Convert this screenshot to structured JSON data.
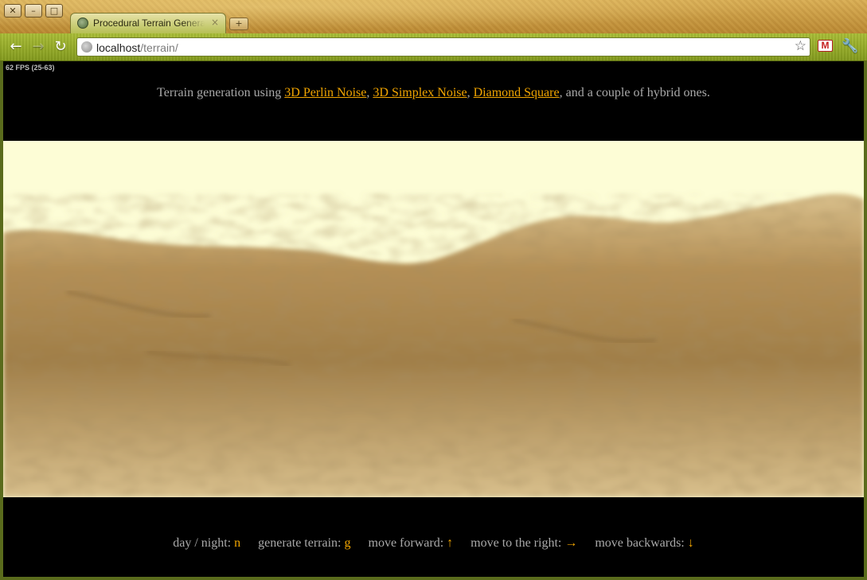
{
  "browser": {
    "tab": {
      "title": "Procedural Terrain Generator",
      "close": "×"
    },
    "new_tab": "+",
    "window_buttons": {
      "close": "✕",
      "minimize": "–",
      "maximize": "□"
    },
    "url_host": "localhost",
    "url_path": "/terrain/",
    "icons": [
      "back-arrow-icon",
      "forward-arrow-icon",
      "reload-icon",
      "globe-icon",
      "star-icon",
      "gmail-icon",
      "wrench-icon"
    ]
  },
  "page": {
    "fps": "62 FPS (25-63)",
    "intro": {
      "prefix": "Terrain generation using ",
      "link1": "3D Perlin Noise",
      "sep1": ", ",
      "link2": "3D Simplex Noise",
      "sep2": ", ",
      "link3": "Diamond Square",
      "suffix": ", and a couple of hybrid ones."
    },
    "controls": [
      {
        "label": "day / night: ",
        "key": "n"
      },
      {
        "label": "generate terrain: ",
        "key": "g"
      },
      {
        "label": "move forward: ",
        "key": "↑"
      },
      {
        "label": "move to the right: ",
        "key": "→"
      },
      {
        "label": "move backwards: ",
        "key": "↓"
      }
    ],
    "colors": {
      "link": "#f0a400",
      "text": "#a9a9a9",
      "sky": "#fdfdd6",
      "terrain": "#b08a4e"
    }
  }
}
